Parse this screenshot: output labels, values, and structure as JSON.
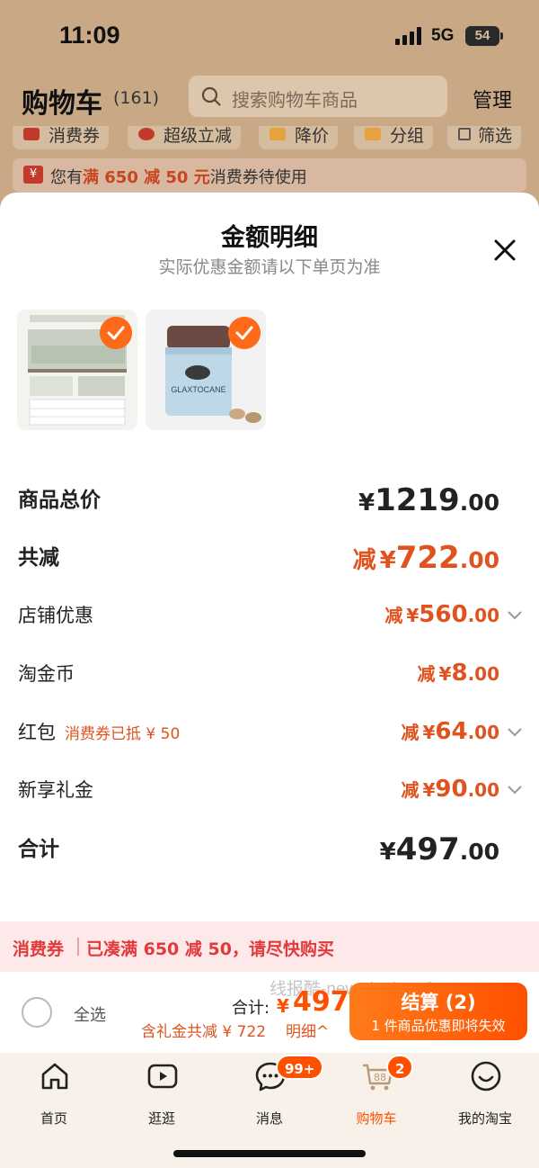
{
  "status_bar": {
    "time": "11:09",
    "network": "5G",
    "battery": "54"
  },
  "header": {
    "title": "购物车",
    "count": "(161)",
    "search_placeholder": "搜索购物车商品",
    "manage": "管理"
  },
  "filters": [
    "消费券",
    "超级立减",
    "降价",
    "分组",
    "筛选"
  ],
  "coupon_banner": {
    "prefix": "您有",
    "highlight": "满 650 减 50 元",
    "suffix": "消费券待使用",
    "tag": "¥"
  },
  "sheet": {
    "title": "金额明细",
    "subtitle": "实际优惠金额请以下单页为准",
    "products": [
      {
        "name": "mattress-product-thumbnail",
        "check": true
      },
      {
        "name": "glaxtocane-product-thumbnail",
        "brand_text": "GLAXTOCANE",
        "check": true
      }
    ],
    "rows": {
      "total_price": {
        "label": "商品总价",
        "currency": "¥",
        "int": "1219",
        "dec": ".00"
      },
      "total_discount": {
        "label": "共减",
        "prefix": "减",
        "currency": "¥",
        "int": "722",
        "dec": ".00"
      },
      "store_discount": {
        "label": "店铺优惠",
        "prefix": "减",
        "currency": "¥",
        "int": "560",
        "dec": ".00"
      },
      "taojin_coin": {
        "label": "淘金币",
        "prefix": "减",
        "currency": "¥",
        "int": "8",
        "dec": ".00"
      },
      "red_packet": {
        "label": "红包",
        "sub": "消费券已抵 ¥ 50",
        "prefix": "减",
        "currency": "¥",
        "int": "64",
        "dec": ".00"
      },
      "new_gift": {
        "label": "新享礼金",
        "prefix": "减",
        "currency": "¥",
        "int": "90",
        "dec": ".00"
      },
      "subtotal": {
        "label": "合计",
        "currency": "¥",
        "int": "497",
        "dec": ".00"
      }
    }
  },
  "coupon_strip": {
    "label": "消费券",
    "text": "已凑满 650 减 50，请尽快购买"
  },
  "checkout": {
    "select_all": "全选",
    "watermark": "线报酷-new.xianbao.fun",
    "total_label": "合计:",
    "total_currency": "¥",
    "total_value": "497",
    "gift_line": "含礼金共减 ¥ 722",
    "detail_link": "明细^",
    "pay_label": "结算 (2)",
    "pay_sub": "1 件商品优惠即将失效"
  },
  "tabbar": {
    "tabs": [
      {
        "label": "首页",
        "icon": "home-icon"
      },
      {
        "label": "逛逛",
        "icon": "video-play-icon"
      },
      {
        "label": "消息",
        "icon": "chat-bubble-icon",
        "badge": "99+"
      },
      {
        "label": "购物车",
        "icon": "cart-icon",
        "badge": "2",
        "cart_number": "88",
        "active": true
      },
      {
        "label": "我的淘宝",
        "icon": "smile-face-icon"
      }
    ]
  },
  "colors": {
    "accent": "#ff5000",
    "discount": "#e0531f",
    "coupon_red": "#e23a3a",
    "dim_bg": "#c9a985"
  }
}
